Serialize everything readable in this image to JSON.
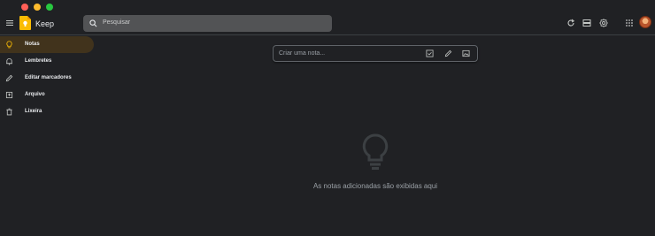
{
  "app": {
    "name": "Keep"
  },
  "search": {
    "placeholder": "Pesquisar"
  },
  "sidebar": {
    "items": [
      {
        "label": "Notas",
        "icon": "bulb-icon",
        "active": true
      },
      {
        "label": "Lembretes",
        "icon": "bell-icon"
      },
      {
        "label": "Editar marcadores",
        "icon": "pencil-icon"
      },
      {
        "label": "Arquivo",
        "icon": "archive-icon"
      },
      {
        "label": "Lixeira",
        "icon": "trash-icon"
      }
    ]
  },
  "note_input": {
    "placeholder": "Criar uma nota..."
  },
  "empty_state": {
    "message": "As notas adicionadas são exibidas aqui"
  },
  "colors": {
    "background": "#202124",
    "active_nav": "#41331c",
    "search_bg": "#525355",
    "accent": "#fbbc04"
  }
}
